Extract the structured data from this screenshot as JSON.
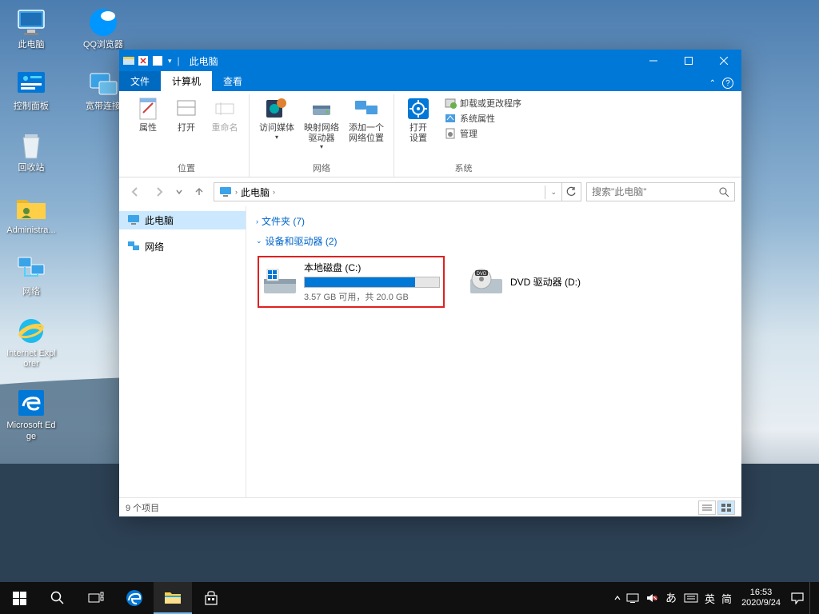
{
  "desktop": {
    "icons": [
      {
        "id": "this-pc",
        "label": "此电脑",
        "glyph": "pc"
      },
      {
        "id": "qq-browser",
        "label": "QQ浏览器",
        "glyph": "qq"
      },
      {
        "id": "control-panel",
        "label": "控制面板",
        "glyph": "cpanel"
      },
      {
        "id": "dialup",
        "label": "宽带连接",
        "glyph": "dialup"
      },
      {
        "id": "recycle-bin",
        "label": "回收站",
        "glyph": "recycle"
      },
      {
        "id": "admin-folder",
        "label": "Administra...",
        "glyph": "folder"
      },
      {
        "id": "network",
        "label": "网络",
        "glyph": "network"
      },
      {
        "id": "ie",
        "label": "Internet Explorer",
        "glyph": "ie"
      },
      {
        "id": "edge",
        "label": "Microsoft Edge",
        "glyph": "edge"
      }
    ]
  },
  "window": {
    "title": "此电脑",
    "tabs": {
      "file": "文件",
      "computer": "计算机",
      "view": "查看"
    },
    "ribbon": {
      "groups": {
        "location": {
          "label": "位置",
          "items": [
            {
              "id": "properties",
              "label": "属性"
            },
            {
              "id": "open",
              "label": "打开"
            },
            {
              "id": "rename",
              "label": "重命名",
              "disabled": true
            }
          ]
        },
        "network": {
          "label": "网络",
          "items": [
            {
              "id": "access-media",
              "label": "访问媒体"
            },
            {
              "id": "map-drive",
              "label": "映射网络\n驱动器"
            },
            {
              "id": "add-netloc",
              "label": "添加一个\n网络位置"
            }
          ]
        },
        "system": {
          "label": "系统",
          "items": [
            {
              "id": "open-settings",
              "label": "打开\n设置"
            }
          ],
          "links": [
            {
              "id": "uninstall",
              "label": "卸载或更改程序"
            },
            {
              "id": "sys-props",
              "label": "系统属性"
            },
            {
              "id": "manage",
              "label": "管理"
            }
          ]
        }
      }
    },
    "breadcrumb": {
      "root": "此电脑"
    },
    "search_placeholder": "搜索\"此电脑\"",
    "sidebar": [
      {
        "id": "this-pc",
        "label": "此电脑",
        "selected": true
      },
      {
        "id": "network",
        "label": "网络"
      }
    ],
    "content": {
      "folders_header": "文件夹 (7)",
      "drives_header": "设备和驱动器 (2)",
      "drives": [
        {
          "id": "c-drive",
          "name": "本地磁盘 (C:)",
          "subtitle": "3.57 GB 可用，共 20.0 GB",
          "used_pct": 82,
          "selected": true
        },
        {
          "id": "d-drive",
          "name": "DVD 驱动器 (D:)"
        }
      ]
    },
    "status": {
      "count": "9 个项目"
    }
  },
  "taskbar": {
    "clock": {
      "time": "16:53",
      "date": "2020/9/24"
    },
    "ime": {
      "lang": "英",
      "mode": "简"
    }
  }
}
